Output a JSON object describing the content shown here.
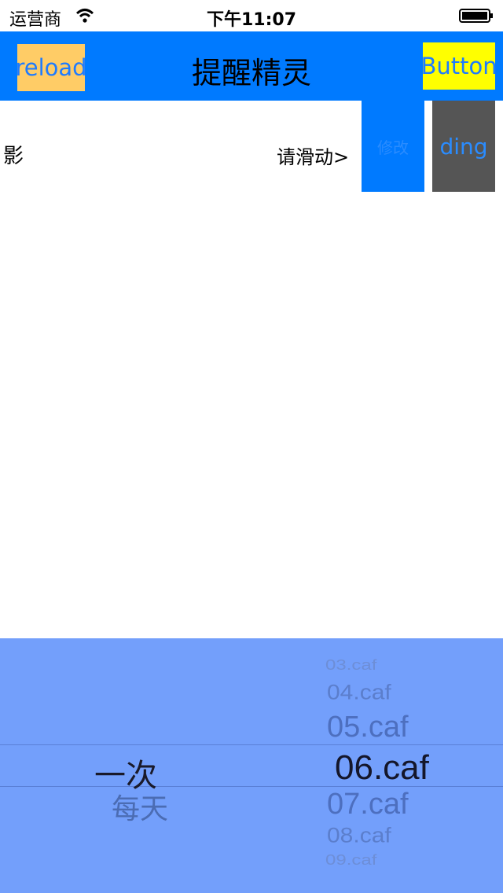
{
  "status_bar": {
    "carrier": "运营商",
    "time": "下午11:07"
  },
  "nav": {
    "left_button": "reload",
    "title": "提醒精灵",
    "right_button": "Button"
  },
  "row": {
    "left_text": "影",
    "right_text": "请滑动>",
    "action_blue": "修改",
    "action_gray": "ding"
  },
  "picker": {
    "left_column": {
      "selected": "一次",
      "next": "每天"
    },
    "right_column": {
      "items": [
        "03.caf",
        "04.caf",
        "05.caf",
        "06.caf",
        "07.caf",
        "08.caf",
        "09.caf"
      ],
      "selected": "06.caf"
    }
  },
  "colors": {
    "nav_bar": "#007aff",
    "reload_bg": "#ffcc66",
    "button_bg": "#ffff00",
    "picker_bg": "#739ffb",
    "action_gray": "#555555"
  }
}
